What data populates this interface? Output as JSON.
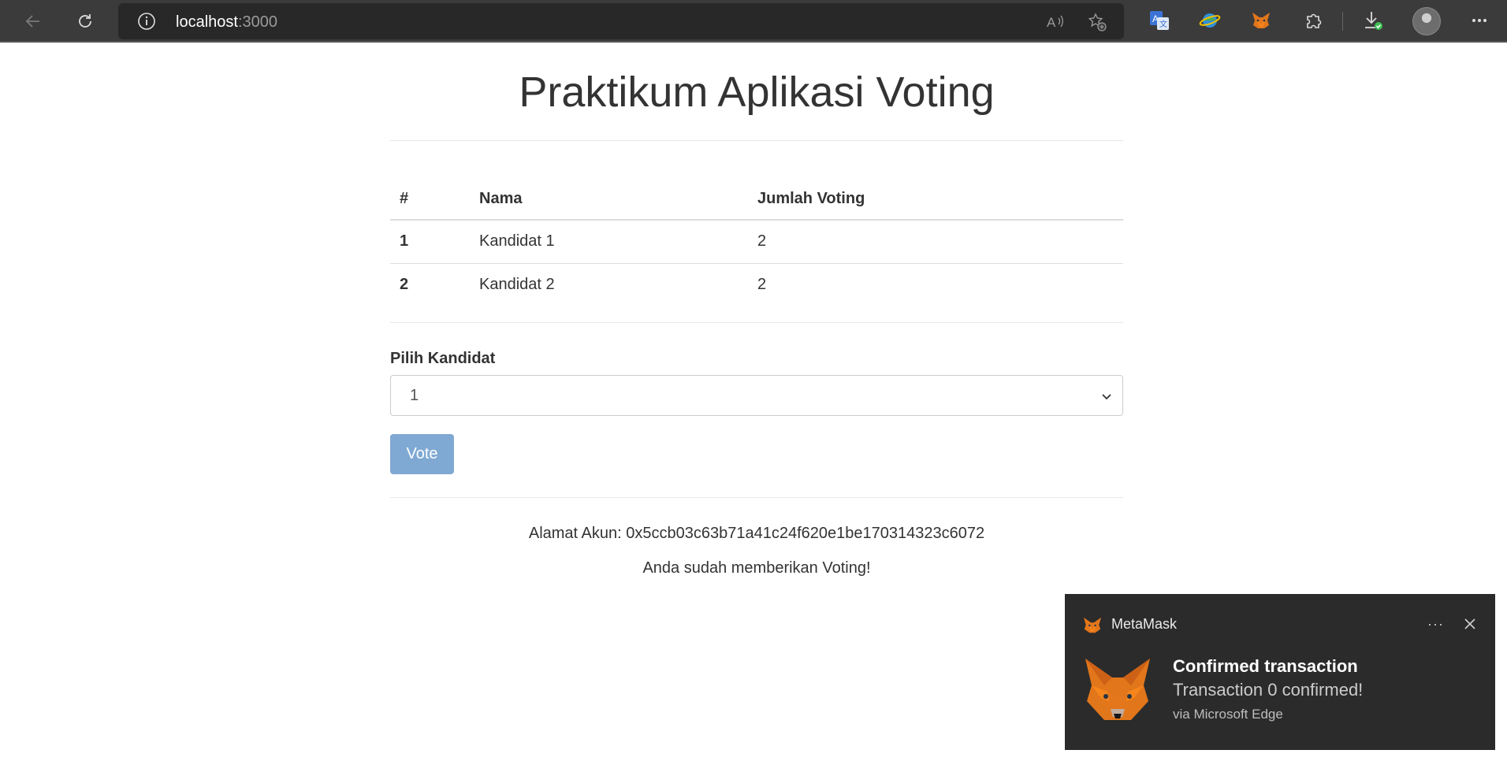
{
  "browser": {
    "url_host": "localhost",
    "url_port": ":3000"
  },
  "page": {
    "title": "Praktikum Aplikasi Voting",
    "table": {
      "headers": [
        "#",
        "Nama",
        "Jumlah Voting"
      ],
      "rows": [
        {
          "id": "1",
          "name": "Kandidat 1",
          "votes": "2"
        },
        {
          "id": "2",
          "name": "Kandidat 2",
          "votes": "2"
        }
      ]
    },
    "form": {
      "label": "Pilih Kandidat",
      "selected": "1",
      "button": "Vote"
    },
    "account_text": "Alamat Akun: 0x5ccb03c63b71a41c24f620e1be170314323c6072",
    "status_text": "Anda sudah memberikan Voting!"
  },
  "notification": {
    "app_name": "MetaMask",
    "more": "···",
    "title": "Confirmed transaction",
    "message": "Transaction 0 confirmed!",
    "source": "via Microsoft Edge"
  }
}
